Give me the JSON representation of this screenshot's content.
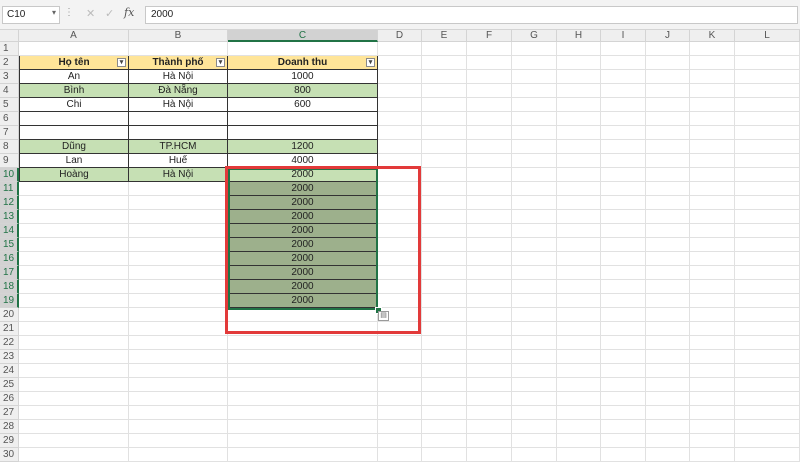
{
  "formula_bar": {
    "name_box": "C10",
    "formula": "2000",
    "cancel_icon": "close-icon",
    "enter_icon": "check-icon",
    "fx_label": "fx"
  },
  "columns": [
    "A",
    "B",
    "C",
    "D",
    "E",
    "F",
    "G",
    "H",
    "I",
    "J",
    "K",
    "L"
  ],
  "selected_column": "C",
  "rows": [
    "1",
    "2",
    "3",
    "4",
    "5",
    "6",
    "7",
    "8",
    "9",
    "10",
    "11",
    "12",
    "13",
    "14",
    "15",
    "16",
    "17",
    "18",
    "19",
    "20",
    "21",
    "22",
    "23",
    "24",
    "25",
    "26",
    "27",
    "28",
    "29",
    "30"
  ],
  "selected_rows": [
    "10",
    "11",
    "12",
    "13",
    "14",
    "15",
    "16",
    "17",
    "18",
    "19"
  ],
  "table": {
    "headers": [
      "Họ tên",
      "Thành phố",
      "Doanh thu"
    ],
    "rows": [
      [
        "An",
        "Hà Nội",
        "1000"
      ],
      [
        "Bình",
        "Đà Nẵng",
        "800"
      ],
      [
        "Chi",
        "Hà Nội",
        "600"
      ],
      [
        "",
        "",
        ""
      ],
      [
        "",
        "",
        ""
      ],
      [
        "Dũng",
        "TP.HCM",
        "1200"
      ],
      [
        "Lan",
        "Huế",
        "4000"
      ],
      [
        "Hoàng",
        "Hà Nội",
        "2000"
      ]
    ],
    "filled_values": [
      "2000",
      "2000",
      "2000",
      "2000",
      "2000",
      "2000",
      "2000",
      "2000",
      "2000"
    ]
  },
  "colors": {
    "header_fill": "#ffe599",
    "row_fill": "#c6e0b4",
    "selection_fill": "#9db08c",
    "selection_border": "#217346",
    "highlight_box": "#e23a3a"
  }
}
